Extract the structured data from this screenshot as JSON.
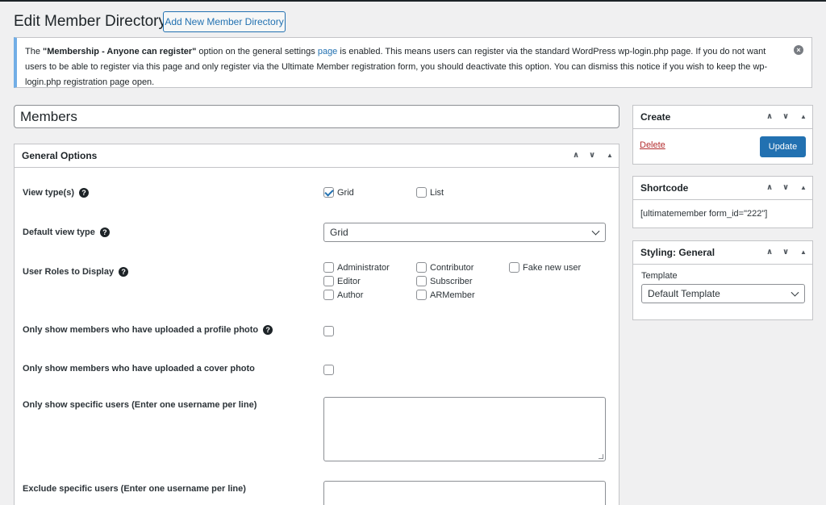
{
  "page": {
    "title": "Edit Member Directory",
    "add_new_label": "Add New Member Directory"
  },
  "notice": {
    "text_prefix": "The ",
    "bold_option": "\"Membership - Anyone can register\"",
    "text_mid": " option on the general settings ",
    "link_text": "page",
    "text_suffix": " is enabled. This means users can register via the standard WordPress wp-login.php page. If you do not want users to be able to register via this page and only register via the Ultimate Member registration form, you should deactivate this option. You can dismiss this notice if you wish to keep the wp-login.php registration page open.",
    "dismiss_glyph": "×"
  },
  "directory_title": "Members",
  "general_options": {
    "title": "General Options",
    "view_types_label": "View type(s)",
    "view_types": [
      {
        "label": "Grid",
        "checked": true
      },
      {
        "label": "List",
        "checked": false
      }
    ],
    "default_view_label": "Default view type",
    "default_view_value": "Grid",
    "roles_label": "User Roles to Display",
    "roles": [
      {
        "label": "Administrator",
        "checked": false
      },
      {
        "label": "Contributor",
        "checked": false
      },
      {
        "label": "Fake new user",
        "checked": false
      },
      {
        "label": "Editor",
        "checked": false
      },
      {
        "label": "Subscriber",
        "checked": false
      },
      {
        "label": "Author",
        "checked": false
      },
      {
        "label": "ARMember",
        "checked": false
      }
    ],
    "profile_photo_label": "Only show members who have uploaded a profile photo",
    "cover_photo_label": "Only show members who have uploaded a cover photo",
    "specific_users_label": "Only show specific users (Enter one username per line)",
    "exclude_users_label": "Exclude specific users (Enter one username per line)"
  },
  "create_box": {
    "title": "Create",
    "delete_label": "Delete",
    "update_label": "Update"
  },
  "shortcode_box": {
    "title": "Shortcode",
    "value": "[ultimatemember form_id=\"222\"]"
  },
  "styling_box": {
    "title": "Styling: General",
    "template_label": "Template",
    "template_value": "Default Template"
  },
  "icons": {
    "up": "∧",
    "down": "∨",
    "toggle": "▲",
    "help": "?"
  },
  "colors": {
    "accent": "#2271b1",
    "notice_border": "#72aee6",
    "delete": "#b32d2e",
    "background": "#f0f0f1"
  }
}
